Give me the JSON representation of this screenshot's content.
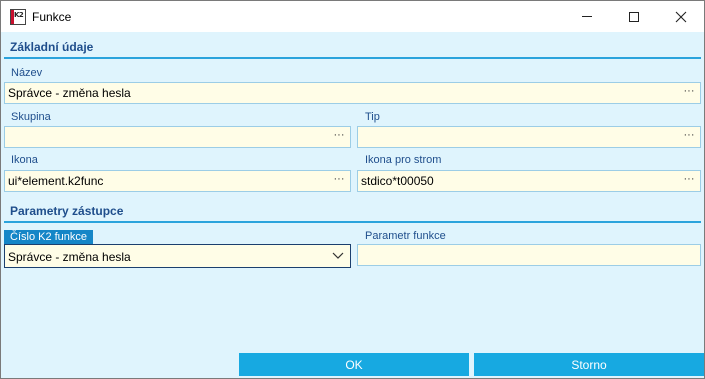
{
  "window": {
    "title": "Funkce",
    "app_icon_text": "K2"
  },
  "sections": {
    "basic": "Základní údaje",
    "params": "Parametry zástupce"
  },
  "fields": {
    "nazev": {
      "label": "Název",
      "value": "Správce - změna hesla"
    },
    "skupina": {
      "label": "Skupina",
      "value": ""
    },
    "tip": {
      "label": "Tip",
      "value": ""
    },
    "ikona": {
      "label": "Ikona",
      "value": "ui*element.k2func"
    },
    "ikona_strom": {
      "label": "Ikona pro strom",
      "value": "stdico*t00050"
    },
    "cislo_funkce": {
      "label": "Číslo K2 funkce",
      "value": "Správce - změna hesla"
    },
    "parametr": {
      "label": "Parametr funkce",
      "value": ""
    }
  },
  "ellipsis": "···",
  "buttons": {
    "ok": "OK",
    "storno": "Storno"
  },
  "colors": {
    "background": "#dff4fd",
    "field_bg": "#fffde7",
    "accent": "#17a9e1",
    "label": "#1f4e8c"
  }
}
